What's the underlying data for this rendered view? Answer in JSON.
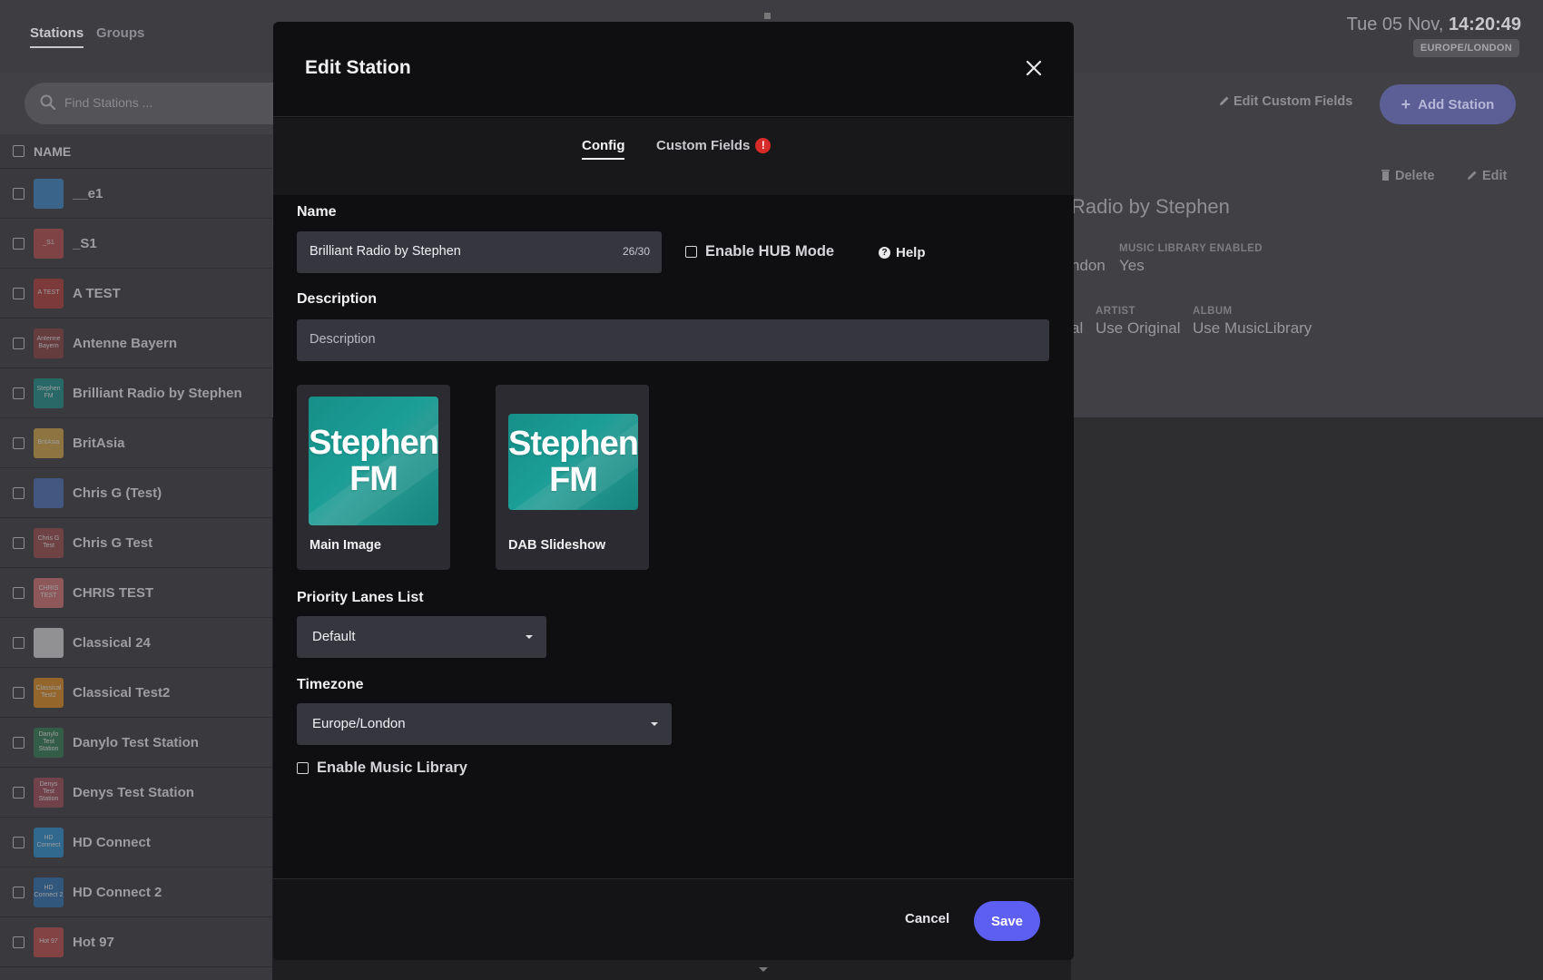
{
  "header": {
    "tabs": [
      {
        "label": "Stations",
        "active": true
      },
      {
        "label": "Groups",
        "active": false
      }
    ],
    "clock_date": "Tue 05 Nov,",
    "clock_time": "14:20:49",
    "timezone_badge": "EUROPE/LONDON",
    "edit_custom_fields": "Edit Custom Fields",
    "add_station": "Add Station"
  },
  "search": {
    "placeholder": "Find Stations ..."
  },
  "list": {
    "column_header": "NAME",
    "rows": [
      {
        "label": "__e1",
        "thumb_text": "",
        "thumb_color": "#3b86c7"
      },
      {
        "label": "_S1",
        "thumb_text": "_S1",
        "thumb_color": "#b94b4b"
      },
      {
        "label": "A TEST",
        "thumb_text": "A TEST",
        "thumb_color": "#b33a3a"
      },
      {
        "label": "Antenne Bayern",
        "thumb_text": "Antenne Bayern",
        "thumb_color": "#8a4040"
      },
      {
        "label": "Brilliant Radio by Stephen",
        "thumb_text": "Stephen FM",
        "thumb_color": "#1a8f88"
      },
      {
        "label": "BritAsia",
        "thumb_text": "BritAsia",
        "thumb_color": "#d1a444"
      },
      {
        "label": "Chris G (Test)",
        "thumb_text": "",
        "thumb_color": "#4a6fb8"
      },
      {
        "label": "Chris G Test",
        "thumb_text": "Chris G Test",
        "thumb_color": "#9c4a4a"
      },
      {
        "label": "CHRIS TEST",
        "thumb_text": "CHRIS TEST",
        "thumb_color": "#d47070"
      },
      {
        "label": "Classical 24",
        "thumb_text": "",
        "thumb_color": "#d8d8d8"
      },
      {
        "label": "Classical Test2",
        "thumb_text": "Classical Test2",
        "thumb_color": "#e08a1c"
      },
      {
        "label": "Danylo Test Station",
        "thumb_text": "Danylo Test Station",
        "thumb_color": "#2f7a52"
      },
      {
        "label": "Denys Test Station",
        "thumb_text": "Denys Test Station",
        "thumb_color": "#a04a55"
      },
      {
        "label": "HD Connect",
        "thumb_text": "HD Connect",
        "thumb_color": "#2a8fd0"
      },
      {
        "label": "HD Connect 2",
        "thumb_text": "HD Connect 2",
        "thumb_color": "#2a6fb0"
      },
      {
        "label": "Hot 97",
        "thumb_text": "Hot 97",
        "thumb_color": "#c04a4a"
      }
    ]
  },
  "details": {
    "delete": "Delete",
    "edit": "Edit",
    "title": "Radio by Stephen",
    "fields": [
      {
        "label": "MUSIC LIBRARY ENABLED",
        "value": "Yes"
      },
      {
        "label": "ARTIST",
        "value": "Use Original"
      },
      {
        "label": "ALBUM",
        "value": "Use MusicLibrary"
      }
    ],
    "partial_left_1": "ndon",
    "partial_left_2": "al"
  },
  "modal": {
    "title": "Edit Station",
    "tabs": [
      {
        "label": "Config",
        "active": true
      },
      {
        "label": "Custom Fields",
        "active": false,
        "alert": "!"
      }
    ],
    "name_label": "Name",
    "name_value": "Brilliant Radio by Stephen",
    "name_counter": "26/30",
    "hub_mode_label": "Enable HUB Mode",
    "help_label": "Help",
    "description_label": "Description",
    "description_placeholder": "Description",
    "images": [
      {
        "caption": "Main Image",
        "logo_line1": "Stephen",
        "logo_line2": "FM"
      },
      {
        "caption": "DAB Slideshow",
        "logo_line1": "Stephen",
        "logo_line2": "FM"
      }
    ],
    "priority_label": "Priority Lanes List",
    "priority_value": "Default",
    "timezone_label": "Timezone",
    "timezone_value": "Europe/London",
    "music_library_label": "Enable Music Library",
    "cancel": "Cancel",
    "save": "Save"
  },
  "colors": {
    "accent": "#5d5ff2",
    "modal_bg": "#0f0f12",
    "input_bg": "#36363f",
    "logo_teal": "#1a8f88",
    "alert_red": "#d92a2a"
  }
}
